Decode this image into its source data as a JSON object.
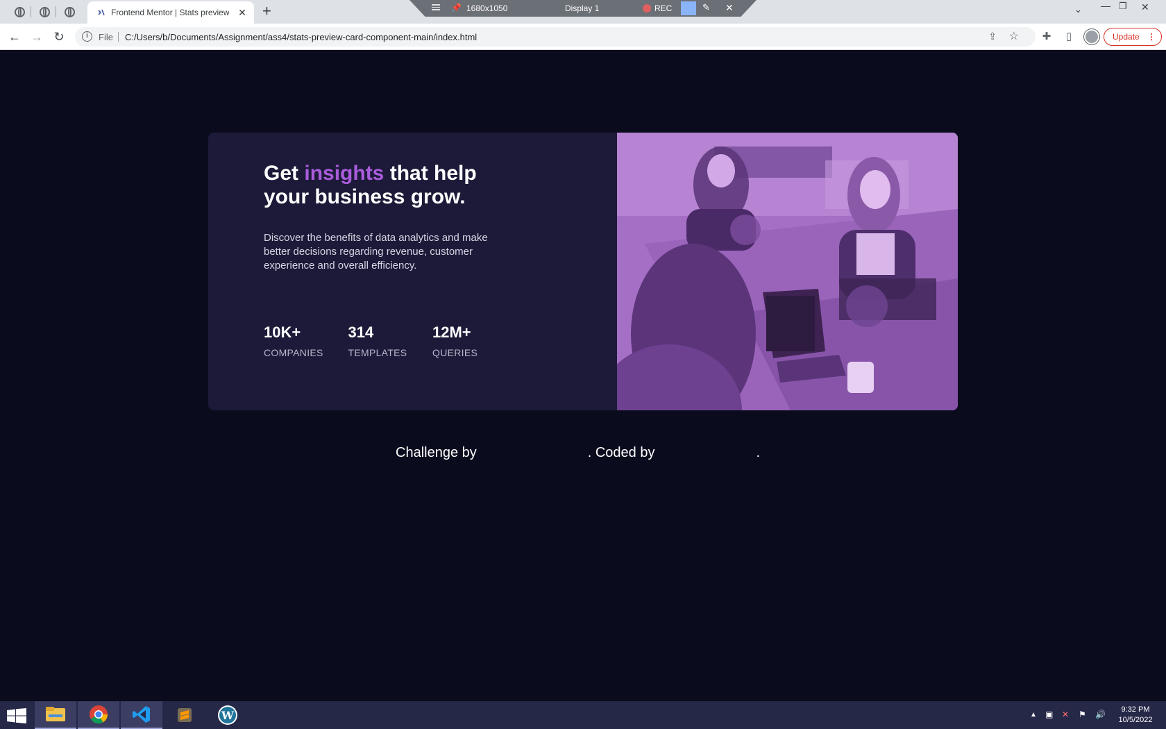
{
  "browser": {
    "active_tab_title": "Frontend Mentor | Stats preview",
    "new_tab_symbol": "+",
    "close_symbol": "✕",
    "address_label": "File",
    "url": "C:/Users/b/Documents/Assignment/ass4/stats-preview-card-component-main/index.html",
    "update_label": "Update"
  },
  "recorder": {
    "resolution": "1680x1050",
    "display": "Display 1",
    "status": "REC"
  },
  "card": {
    "headline_pre": "Get ",
    "headline_accent": "insights",
    "headline_post": " that help your business grow.",
    "description": "Discover the benefits of data analytics and make better decisions regarding revenue, customer experience and overall efficiency.",
    "stats": [
      {
        "value": "10K+",
        "label": "COMPANIES"
      },
      {
        "value": "314",
        "label": "TEMPLATES"
      },
      {
        "value": "12M+",
        "label": "QUERIES"
      }
    ],
    "accent_color": "#aa5cdb",
    "image_overlay_color": "#a26ac4"
  },
  "attribution": {
    "challenge_by": "Challenge by",
    "coded_by": ". Coded by",
    "end": "."
  },
  "taskbar": {
    "apps": [
      "file-explorer",
      "chrome",
      "vscode",
      "sublime-text",
      "wordpress"
    ],
    "time": "9:32 PM",
    "date": "10/5/2022"
  }
}
